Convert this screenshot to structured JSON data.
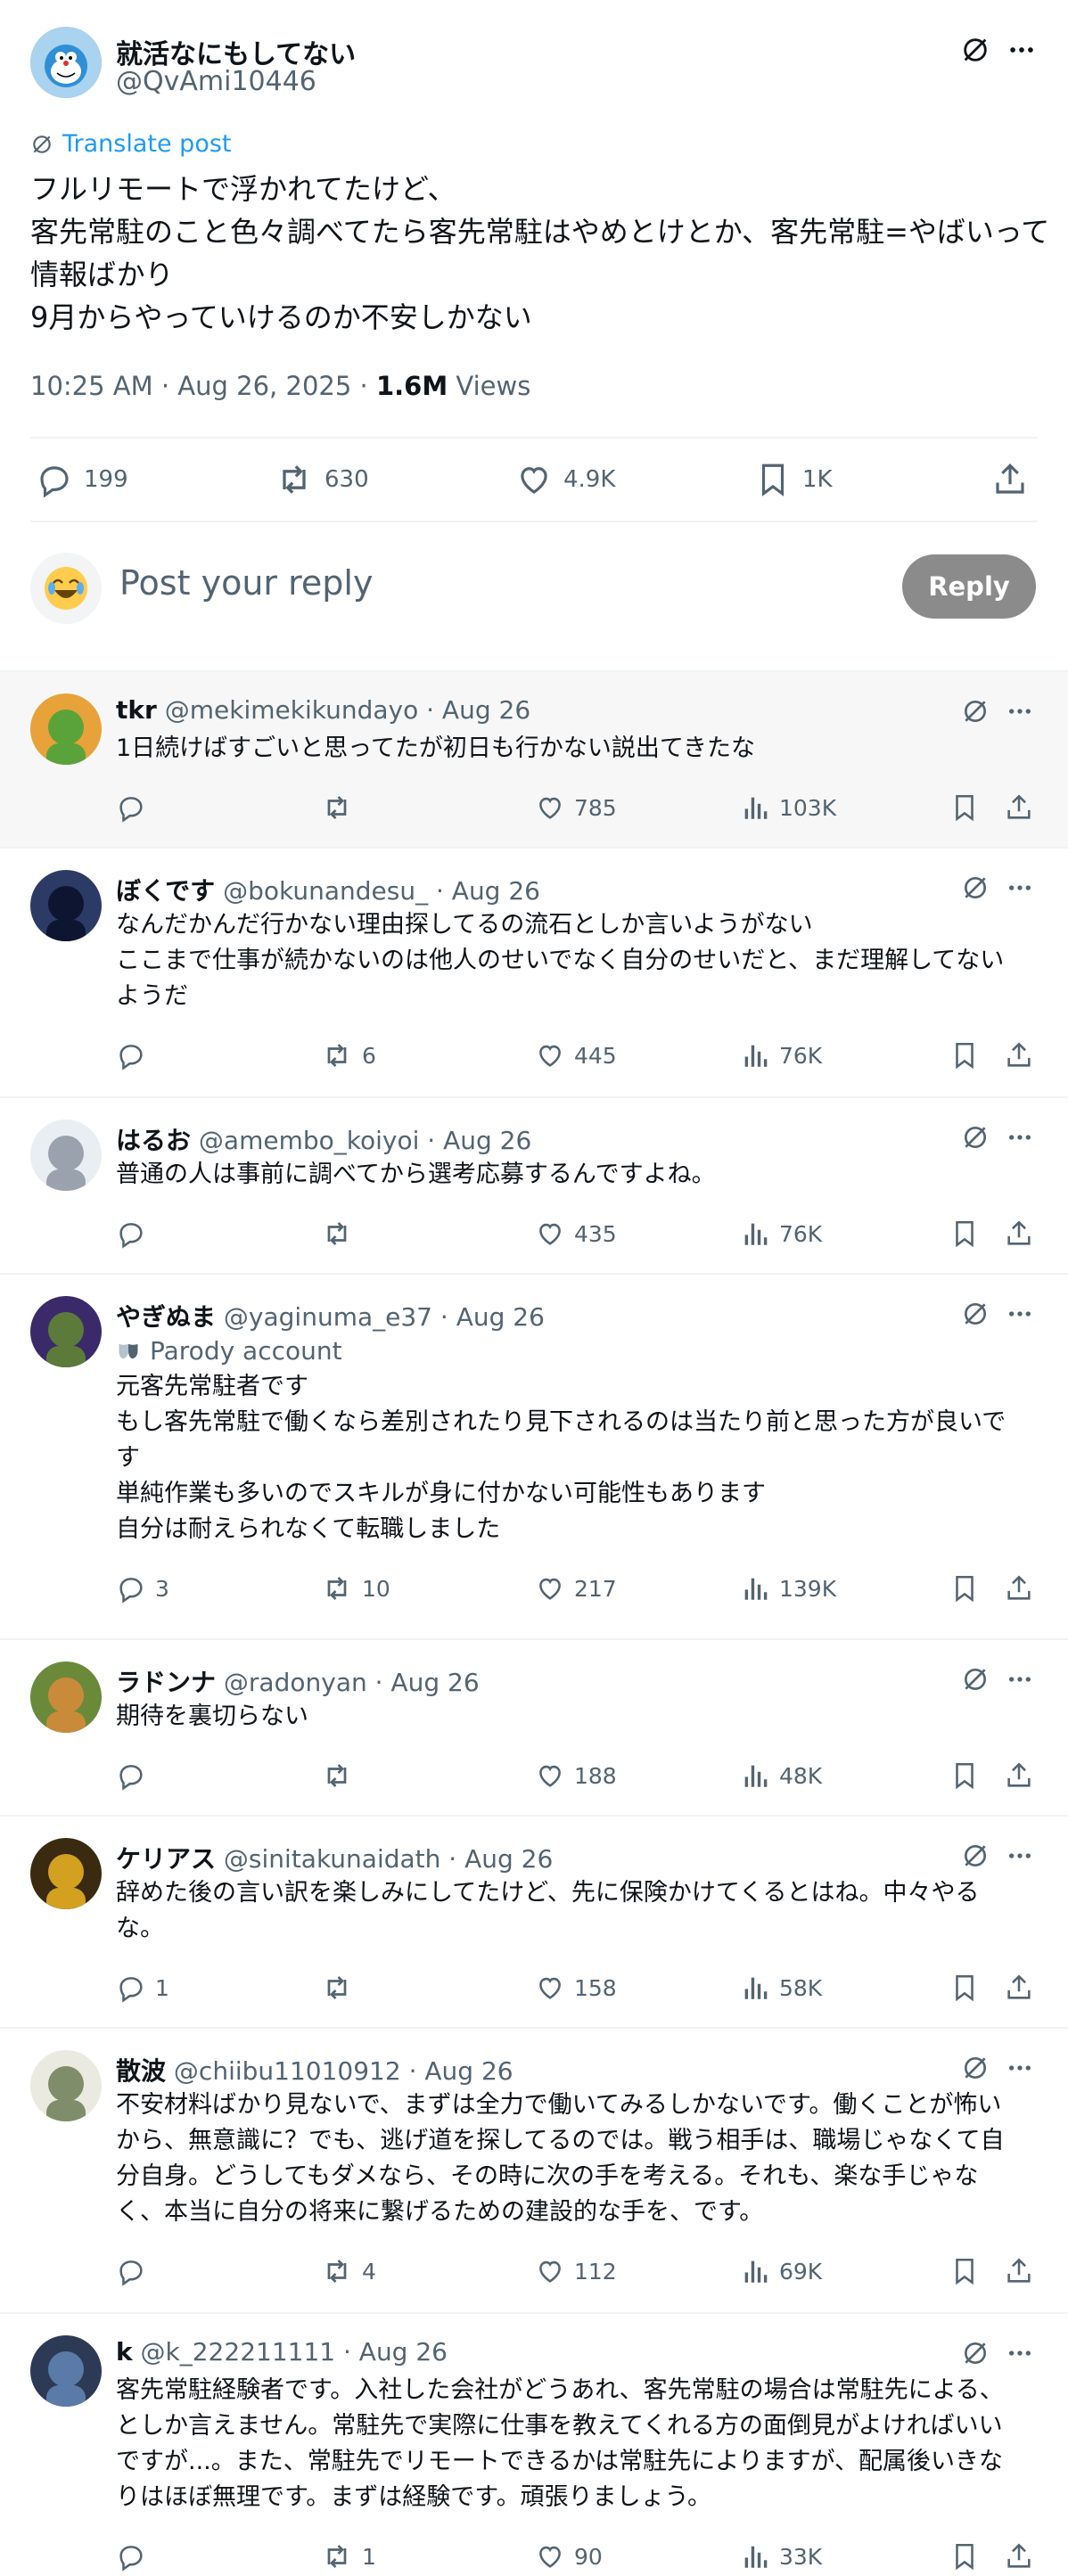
{
  "post": {
    "author_name": "就活なにもしてない",
    "author_handle": "@QvAmi10446",
    "translate_label": "Translate post",
    "body_lines": [
      "フルリモートで浮かれてたけど、",
      "客先常駐のこと色々調べてたら客先常駐はやめとけとか、客先常駐=やばいって",
      "情報ばかり",
      "9月からやっていけるのか不安しかない"
    ],
    "timestamp": "10:25 AM · Aug 26, 2025 · ",
    "views_count": "1.6M",
    "views_label": " Views",
    "stats": {
      "replies": "199",
      "reposts": "630",
      "likes": "4.9K",
      "bookmarks": "1K"
    }
  },
  "composer": {
    "placeholder": "Post your reply",
    "button_label": "Reply",
    "avatar_emoji": "😂"
  },
  "replies": [
    {
      "name": "tkr",
      "handle": "@mekimekikundayo",
      "date": "· Aug 26",
      "lines": [
        "1日続けばすごいと思ってたが初日も行かない説出てきたな"
      ],
      "reply_count": "",
      "repost_count": "",
      "like_count": "785",
      "view_count": "103K"
    },
    {
      "name": "ぼくです",
      "handle": "@bokunandesu_",
      "date": "· Aug 26",
      "lines": [
        "なんだかんだ行かない理由探してるの流石としか言いようがない",
        "ここまで仕事が続かないのは他人のせいでなく自分のせいだと、まだ理解してない",
        "ようだ"
      ],
      "reply_count": "",
      "repost_count": "6",
      "like_count": "445",
      "view_count": "76K"
    },
    {
      "name": "はるお",
      "handle": "@amembo_koiyoi",
      "date": "· Aug 26",
      "lines": [
        "普通の人は事前に調べてから選考応募するんですよね。"
      ],
      "reply_count": "",
      "repost_count": "",
      "like_count": "435",
      "view_count": "76K"
    },
    {
      "name": "やぎぬま",
      "handle": "@yaginuma_e37",
      "date": "· Aug 26",
      "parody_label": "Parody account",
      "lines": [
        "元客先常駐者です",
        "もし客先常駐で働くなら差別されたり見下されるのは当たり前と思った方が良いで",
        "す",
        "単純作業も多いのでスキルが身に付かない可能性もあります",
        "自分は耐えられなくて転職しました"
      ],
      "reply_count": "3",
      "repost_count": "10",
      "like_count": "217",
      "view_count": "139K"
    },
    {
      "name": "ラドンナ",
      "handle": "@radonyan",
      "date": "· Aug 26",
      "lines": [
        "期待を裏切らない"
      ],
      "reply_count": "",
      "repost_count": "",
      "like_count": "188",
      "view_count": "48K"
    },
    {
      "name": "ケリアス",
      "handle": "@sinitakunaidath",
      "date": "· Aug 26",
      "lines": [
        "辞めた後の言い訳を楽しみにしてたけど、先に保険かけてくるとはね。中々やる",
        "な。"
      ],
      "reply_count": "1",
      "repost_count": "",
      "like_count": "158",
      "view_count": "58K"
    },
    {
      "name": "散波",
      "handle": "@chiibu11010912",
      "date": "· Aug 26",
      "lines": [
        "不安材料ばかり見ないで、まずは全力で働いてみるしかないです。働くことが怖い",
        "から、無意識に？でも、逃げ道を探してるのでは。戦う相手は、職場じゃなくて自",
        "分自身。どうしてもダメなら、その時に次の手を考える。それも、楽な手じゃな",
        "く、本当に自分の将来に繋げるための建設的な手を、です。"
      ],
      "reply_count": "",
      "repost_count": "4",
      "like_count": "112",
      "view_count": "69K"
    },
    {
      "name": "k",
      "handle": "@k_222211111",
      "date": "· Aug 26",
      "lines": [
        "客先常駐経験者です。入社した会社がどうあれ、客先常駐の場合は常駐先による、",
        "としか言えません。常駐先で実際に仕事を教えてくれる方の面倒見がよければいい",
        "ですが...。また、常駐先でリモートできるかは常駐先によりますが、配属後いきな",
        "りはほぼ無理です。まずは経験です。頑張りましょう。"
      ],
      "reply_count": "",
      "repost_count": "1",
      "like_count": "90",
      "view_count": "33K"
    }
  ]
}
